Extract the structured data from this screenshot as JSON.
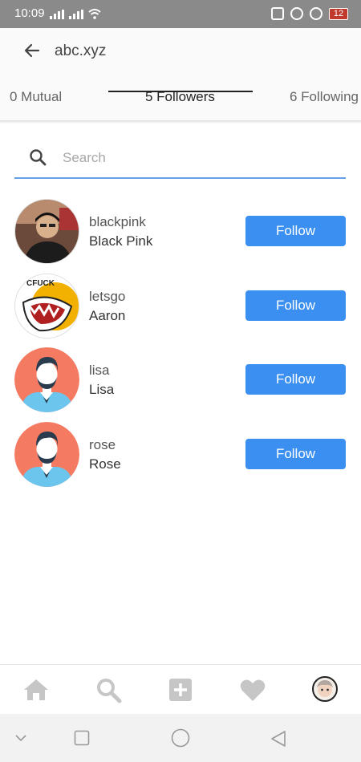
{
  "status_bar": {
    "time": "10:09",
    "battery": "12"
  },
  "header": {
    "title": "abc.xyz"
  },
  "tabs": [
    {
      "label": "0 Mutual"
    },
    {
      "label": "5 Followers"
    },
    {
      "label": "6 Following"
    }
  ],
  "search": {
    "placeholder": "Search",
    "value": ""
  },
  "users": [
    {
      "username": "blackpink",
      "name": "Black Pink",
      "button": "Follow"
    },
    {
      "username": "letsgo",
      "name": "Aaron",
      "button": "Follow"
    },
    {
      "username": "lisa",
      "name": "Lisa",
      "button": "Follow"
    },
    {
      "username": "rose",
      "name": "Rose",
      "button": "Follow"
    }
  ],
  "colors": {
    "accent": "#3a8ff0",
    "avatar_placeholder": "#f47b62"
  },
  "bottom_nav": [
    "home-icon",
    "search-icon",
    "add-post-icon",
    "heart-icon",
    "profile-avatar"
  ]
}
